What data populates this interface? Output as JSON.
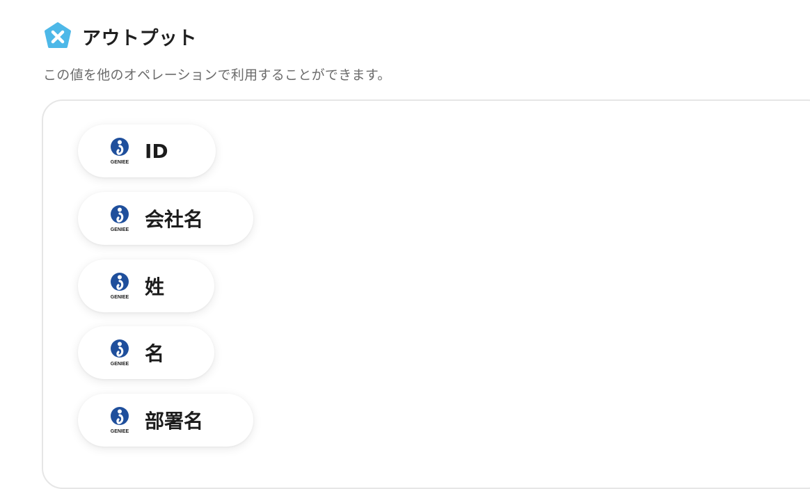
{
  "section": {
    "title": "アウトプット",
    "description": "この値を他のオペレーションで利用することができます。",
    "icon": "x-pentagon-icon",
    "icon_color": "#4db8e8"
  },
  "outputs": {
    "logo_text": "GENIEE",
    "logo_color": "#1f4f9c",
    "items": [
      {
        "label": "ID"
      },
      {
        "label": "会社名"
      },
      {
        "label": "姓"
      },
      {
        "label": "名"
      },
      {
        "label": "部署名"
      }
    ]
  }
}
